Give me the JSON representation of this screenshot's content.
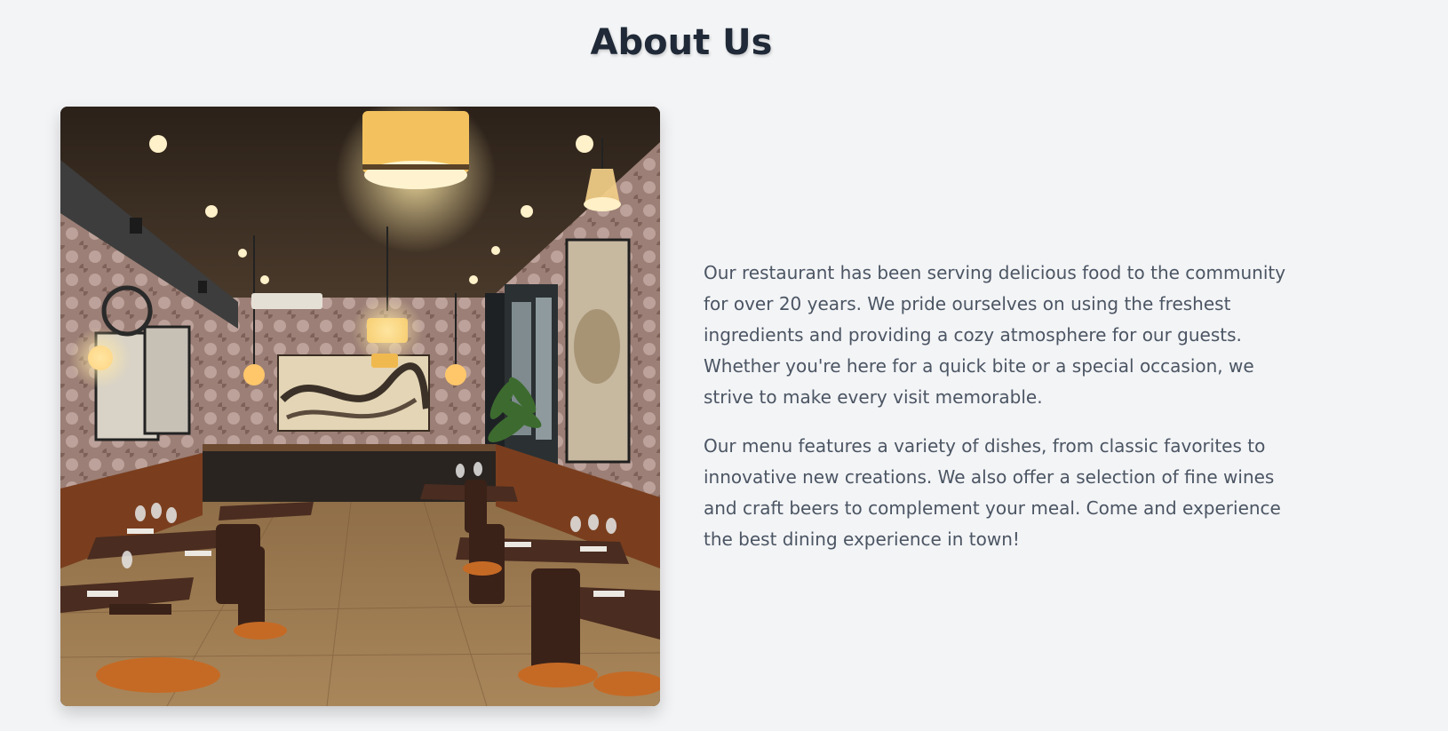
{
  "about": {
    "title": "About Us",
    "paragraphs": [
      "Our restaurant has been serving delicious food to the community for over 20 years. We pride ourselves on using the freshest ingredients and providing a cozy atmosphere for our guests. Whether you're here for a quick bite or a special occasion, we strive to make every visit memorable.",
      "Our menu features a variety of dishes, from classic favorites to innovative new creations. We also offer a selection of fine wines and craft beers to complement your meal. Come and experience the best dining experience in town!"
    ]
  },
  "colors": {
    "page_background": "#f3f4f6",
    "heading": "#1f2937",
    "body_text": "#4b5563"
  }
}
